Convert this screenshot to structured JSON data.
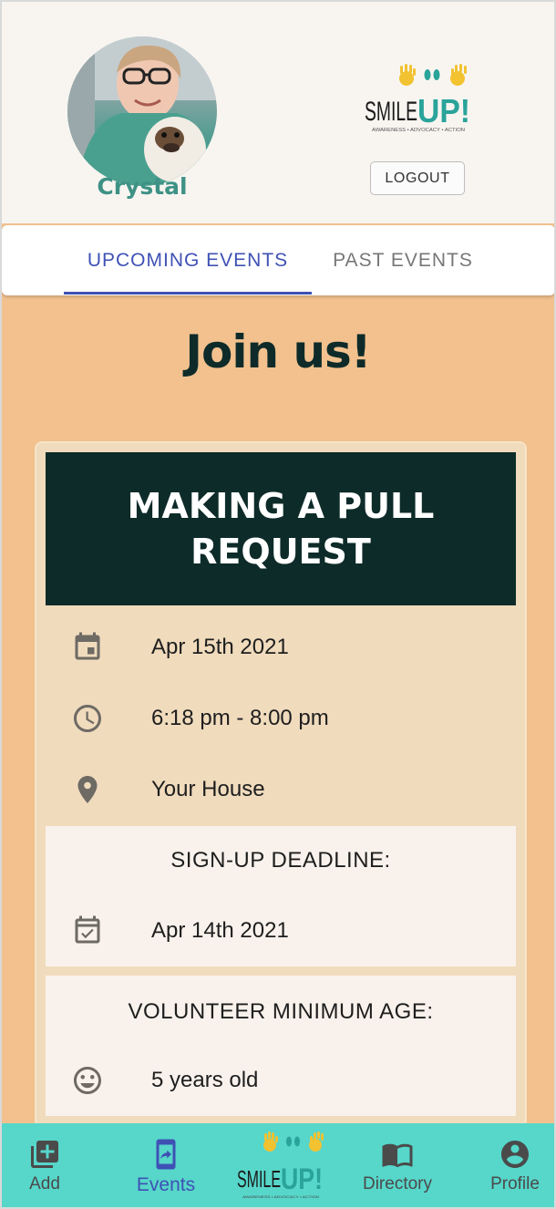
{
  "header": {
    "user_name": "Crystal",
    "logout_label": "LOGOUT",
    "logo": {
      "text_smile": "SMILE",
      "text_up": "UP!",
      "tagline": "AWARENESS • ADVOCACY • ACTION"
    }
  },
  "tabs": [
    {
      "label": "UPCOMING EVENTS",
      "active": true
    },
    {
      "label": "PAST EVENTS",
      "active": false
    }
  ],
  "main": {
    "heading": "Join us!",
    "event": {
      "title": "MAKING A PULL REQUEST",
      "date": "Apr 15th 2021",
      "time": "6:18 pm - 8:00 pm",
      "location": "Your House",
      "deadline_heading": "SIGN-UP DEADLINE:",
      "deadline_date": "Apr 14th 2021",
      "age_heading": "VOLUNTEER MINIMUM AGE:",
      "min_age": "5 years old"
    }
  },
  "bottom_nav": {
    "items": [
      {
        "label": "Add",
        "icon": "add-box-icon",
        "active": false
      },
      {
        "label": "Events",
        "icon": "event-available-icon",
        "active": true
      },
      {
        "label": "Directory",
        "icon": "book-icon",
        "active": false
      },
      {
        "label": "Profile",
        "icon": "account-circle-icon",
        "active": false
      }
    ]
  },
  "colors": {
    "accent": "#3f51b5",
    "header_bg": "#f8f5f1",
    "page_bg": "#f2c18e",
    "card_bg": "#f0dbbd",
    "title_bg": "#0d2b29",
    "nav_bg": "#57d6ca",
    "name_color": "#3e9185",
    "logo_yellow": "#f2c230",
    "logo_teal": "#2aa39a"
  }
}
